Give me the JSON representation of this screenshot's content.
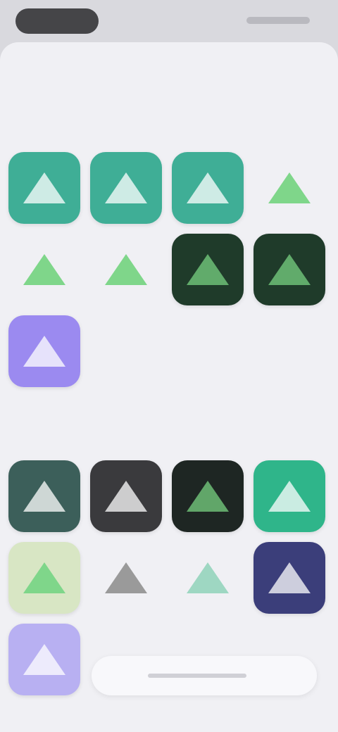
{
  "sheet": {
    "title": ""
  },
  "sections": [
    {
      "label": ""
    },
    {
      "label": ""
    }
  ],
  "icons_section_1": [
    {
      "name": "icon-teal-1",
      "bg": "#3fae96",
      "glyph": "light"
    },
    {
      "name": "icon-teal-2",
      "bg": "#3fae96",
      "glyph": "light"
    },
    {
      "name": "icon-teal-3",
      "bg": "#3fae96",
      "glyph": "light"
    },
    {
      "name": "icon-green-bare-1",
      "bg": "transparent",
      "glyph": "green"
    },
    {
      "name": "icon-green-bare-2",
      "bg": "transparent",
      "glyph": "green"
    },
    {
      "name": "icon-green-bare-3",
      "bg": "transparent",
      "glyph": "green"
    },
    {
      "name": "icon-dark-1",
      "bg": "#1f3b2a",
      "glyph": "dark"
    },
    {
      "name": "icon-dark-2",
      "bg": "#1f3b2a",
      "glyph": "dark"
    },
    {
      "name": "icon-purple",
      "bg": "#9b8af0",
      "glyph": "light"
    }
  ],
  "icons_section_2": [
    {
      "name": "icon-teal-dark",
      "bg": "#3c5f5a",
      "glyph": "light"
    },
    {
      "name": "icon-charcoal",
      "bg": "#3a3a3d",
      "glyph": "light"
    },
    {
      "name": "icon-black",
      "bg": "#1e2623",
      "glyph": "dark"
    },
    {
      "name": "icon-emerald",
      "bg": "#2fb58a",
      "glyph": "light"
    },
    {
      "name": "icon-cream",
      "bg": "#d8e6c4",
      "glyph": "green"
    },
    {
      "name": "icon-grey-bare",
      "bg": "transparent",
      "glyph": "grey"
    },
    {
      "name": "icon-mint-bare",
      "bg": "transparent",
      "glyph": "mint"
    },
    {
      "name": "icon-indigo",
      "bg": "#3b3e7a",
      "glyph": "light"
    },
    {
      "name": "icon-lavender",
      "bg": "#b8b0f2",
      "glyph": "light"
    }
  ]
}
